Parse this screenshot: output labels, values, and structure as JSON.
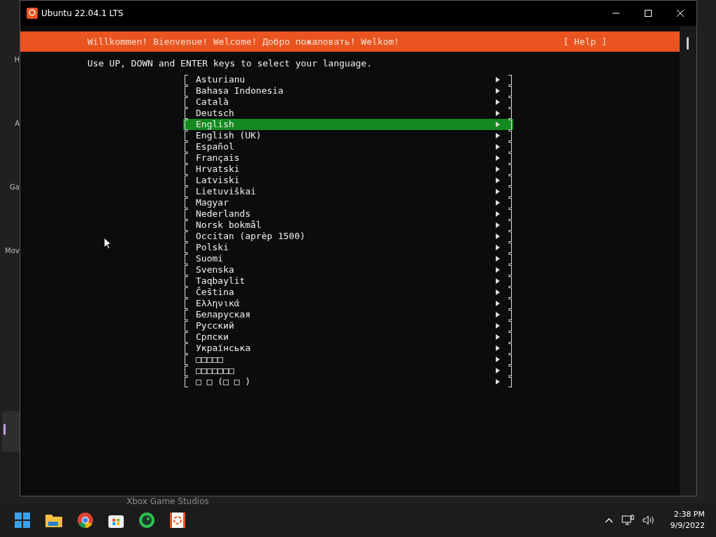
{
  "desktop": {
    "side_labels": [
      "H",
      "A",
      "Ga",
      "Mov"
    ],
    "behind_texts": [
      "Xbox Game Studios"
    ]
  },
  "window": {
    "title": "Ubuntu 22.04.1 LTS"
  },
  "header": {
    "welcome": "Willkommen! Bienvenue! Welcome! Добро пожаловать! Welkom!",
    "help": "[ Help ]"
  },
  "instruction": "Use UP, DOWN and ENTER keys to select your language.",
  "languages": [
    {
      "label": "Asturianu",
      "selected": false
    },
    {
      "label": "Bahasa Indonesia",
      "selected": false
    },
    {
      "label": "Català",
      "selected": false
    },
    {
      "label": "Deutsch",
      "selected": false
    },
    {
      "label": "English",
      "selected": true
    },
    {
      "label": "English (UK)",
      "selected": false
    },
    {
      "label": "Español",
      "selected": false
    },
    {
      "label": "Français",
      "selected": false
    },
    {
      "label": "Hrvatski",
      "selected": false
    },
    {
      "label": "Latviski",
      "selected": false
    },
    {
      "label": "Lietuviškai",
      "selected": false
    },
    {
      "label": "Magyar",
      "selected": false
    },
    {
      "label": "Nederlands",
      "selected": false
    },
    {
      "label": "Norsk bokmål",
      "selected": false
    },
    {
      "label": "Occitan (aprèp 1500)",
      "selected": false
    },
    {
      "label": "Polski",
      "selected": false
    },
    {
      "label": "Suomi",
      "selected": false
    },
    {
      "label": "Svenska",
      "selected": false
    },
    {
      "label": "Taqbaylit",
      "selected": false
    },
    {
      "label": "Čeština",
      "selected": false
    },
    {
      "label": "Ελληνικά",
      "selected": false
    },
    {
      "label": "Беларуская",
      "selected": false
    },
    {
      "label": "Русский",
      "selected": false
    },
    {
      "label": "Српски",
      "selected": false
    },
    {
      "label": "Українська",
      "selected": false
    },
    {
      "label": "□□□□□",
      "selected": false
    },
    {
      "label": "□□□□□□□",
      "selected": false
    },
    {
      "label": "□ □ (□ □ )",
      "selected": false
    }
  ],
  "taskbar": {
    "time": "2:38 PM",
    "date": "9/9/2022"
  }
}
